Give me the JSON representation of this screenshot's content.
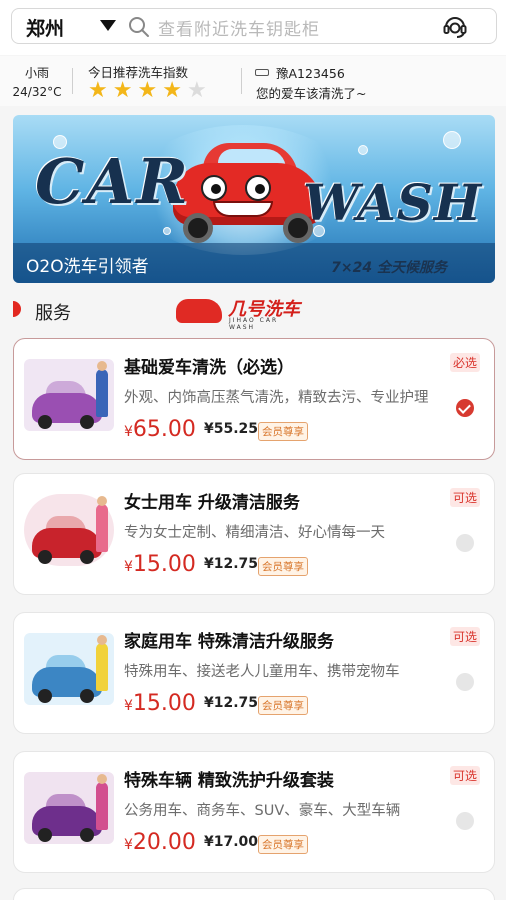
{
  "search": {
    "city": "郑州",
    "placeholder": "查看附近洗车钥匙柜"
  },
  "info": {
    "weather_desc": "小雨",
    "weather_temp": "24/32°C",
    "index_label": "今日推荐洗车指数",
    "index_rating": 4,
    "index_max": 5,
    "plate": "豫A123456",
    "plate_message": "您的爱车该清洗了~"
  },
  "banner": {
    "word_car": "CAR",
    "word_wash": "WASH",
    "slogan": "O2O洗车引领者",
    "hours": "7×24  全天候服务"
  },
  "section": {
    "title": "服务",
    "brand_name": "几号洗车",
    "brand_sub": "JIHAO CAR WASH"
  },
  "services": [
    {
      "title": "基础爱车清洗（必选）",
      "desc": "外观、内饰高压蒸气清洗，精致去污、专业护理",
      "currency": "¥",
      "price": "65.00",
      "member_price": "¥55.25",
      "member_tag": "会员尊享",
      "badge": "必选",
      "selected": true
    },
    {
      "title": "女士用车 升级清洁服务",
      "desc": "专为女士定制、精细清洁、好心情每一天",
      "currency": "¥",
      "price": "15.00",
      "member_price": "¥12.75",
      "member_tag": "会员尊享",
      "badge": "可选",
      "selected": false
    },
    {
      "title": "家庭用车 特殊清洁升级服务",
      "desc": "特殊用车、接送老人儿童用车、携带宠物车",
      "currency": "¥",
      "price": "15.00",
      "member_price": "¥12.75",
      "member_tag": "会员尊享",
      "badge": "可选",
      "selected": false
    },
    {
      "title": "特殊车辆 精致洗护升级套装",
      "desc": "公务用车、商务车、SUV、豪车、大型车辆",
      "currency": "¥",
      "price": "20.00",
      "member_price": "¥17.00",
      "member_tag": "会员尊享",
      "badge": "可选",
      "selected": false
    }
  ],
  "colors": {
    "accent_red": "#d42a22",
    "star_yellow": "#f3b619",
    "vip_orange": "#d8762b"
  }
}
